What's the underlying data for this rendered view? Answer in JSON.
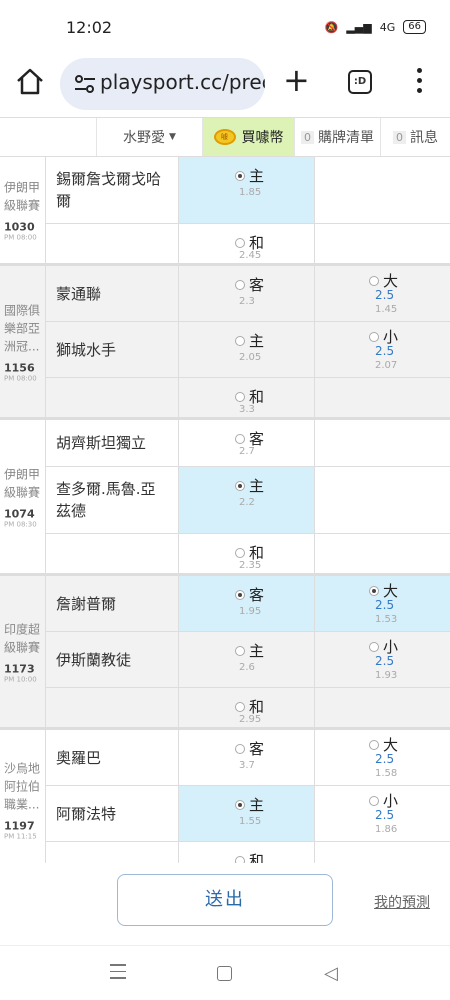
{
  "status": {
    "time": "12:02",
    "signal": "4G",
    "battery": "66"
  },
  "browser": {
    "url": "playsport.cc/pred",
    "tabs_label": ":D"
  },
  "header": {
    "dropdown": "水野愛",
    "buy_label": "買噱幣",
    "coin_text": "噱",
    "cart_count": "0",
    "cart_label": "購牌清單",
    "msg_count": "0",
    "msg_label": "訊息"
  },
  "games": [
    {
      "league": "伊朗甲級聯賽",
      "number": "1030",
      "time": "PM 08:00",
      "rows": [
        {
          "team": "錫爾詹戈爾戈哈爾",
          "pick": "主",
          "odds": "1.85",
          "selected": true,
          "side": null
        },
        {
          "team": "",
          "pick": "和",
          "odds": "2.45",
          "selected": false,
          "side": null
        }
      ]
    },
    {
      "league": "國際俱樂部亞洲冠...",
      "number": "1156",
      "time": "PM 08:00",
      "rows": [
        {
          "team": "蒙通聯",
          "pick": "客",
          "odds": "2.3",
          "selected": false,
          "side": {
            "label": "大",
            "line": "2.5",
            "odds": "1.45",
            "selected": false
          }
        },
        {
          "team": "獅城水手",
          "pick": "主",
          "odds": "2.05",
          "selected": false,
          "side": {
            "label": "小",
            "line": "2.5",
            "odds": "2.07",
            "selected": false
          }
        },
        {
          "team": "",
          "pick": "和",
          "odds": "3.3",
          "selected": false,
          "side": null
        }
      ]
    },
    {
      "league": "伊朗甲級聯賽",
      "number": "1074",
      "time": "PM 08:30",
      "rows": [
        {
          "team": "胡齊斯坦獨立",
          "pick": "客",
          "odds": "2.7",
          "selected": false,
          "side": null
        },
        {
          "team": "查多爾.馬魯.亞茲德",
          "pick": "主",
          "odds": "2.2",
          "selected": true,
          "side": null
        },
        {
          "team": "",
          "pick": "和",
          "odds": "2.35",
          "selected": false,
          "side": null
        }
      ]
    },
    {
      "league": "印度超級聯賽",
      "number": "1173",
      "time": "PM 10:00",
      "rows": [
        {
          "team": "詹謝普爾",
          "pick": "客",
          "odds": "1.95",
          "selected": true,
          "side": {
            "label": "大",
            "line": "2.5",
            "odds": "1.53",
            "selected": true
          }
        },
        {
          "team": "伊斯蘭教徒",
          "pick": "主",
          "odds": "2.6",
          "selected": false,
          "side": {
            "label": "小",
            "line": "2.5",
            "odds": "1.93",
            "selected": false
          }
        },
        {
          "team": "",
          "pick": "和",
          "odds": "2.95",
          "selected": false,
          "side": null
        }
      ]
    },
    {
      "league": "沙烏地阿拉伯職業...",
      "number": "1197",
      "time": "PM 11:15",
      "rows": [
        {
          "team": "奧羅巴",
          "pick": "客",
          "odds": "3.7",
          "selected": false,
          "side": {
            "label": "大",
            "line": "2.5",
            "odds": "1.58",
            "selected": false
          }
        },
        {
          "team": "阿爾法特",
          "pick": "主",
          "odds": "1.55",
          "selected": true,
          "side": {
            "label": "小",
            "line": "2.5",
            "odds": "1.86",
            "selected": false
          }
        },
        {
          "team": "",
          "pick": "和",
          "odds": "",
          "selected": false,
          "side": null
        }
      ]
    }
  ],
  "footer": {
    "submit": "送出",
    "my_prediction": "我的預測"
  }
}
